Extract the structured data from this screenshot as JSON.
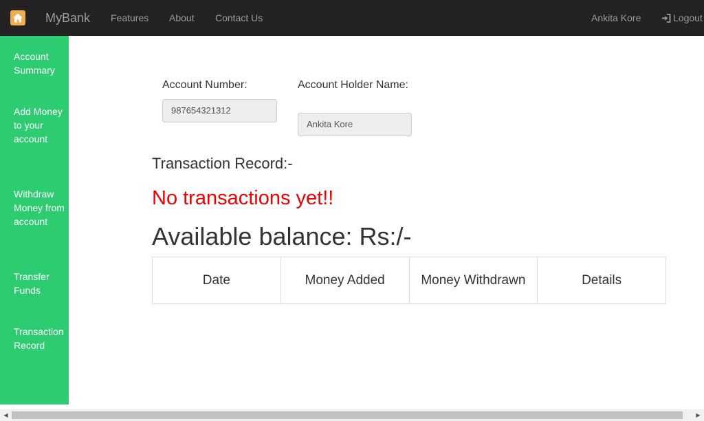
{
  "navbar": {
    "brand": "MyBank",
    "links": [
      "Features",
      "About",
      "Contact Us"
    ],
    "user_name": "Ankita Kore",
    "logout_label": "Logout",
    "bg_color": "#222222",
    "home_badge_color": "#f0ad4e"
  },
  "sidebar": {
    "bg_color": "#2ecc71",
    "items": [
      {
        "label": "Account Summary"
      },
      {
        "label": "Add Money to your account"
      },
      {
        "label": "Withdraw Money from account"
      },
      {
        "label": "Transfer Funds"
      },
      {
        "label": "Transaction Record"
      }
    ]
  },
  "account": {
    "number_label": "Account Number:",
    "number_value": "987654321312",
    "holder_label": "Account Holder Name:",
    "holder_value": "Ankita Kore"
  },
  "transactions": {
    "title": "Transaction Record:-",
    "empty_message": "No transactions yet!!",
    "empty_color": "#ee0000",
    "balance_text": "Available balance: Rs:/-",
    "columns": [
      "Date",
      "Money Added",
      "Money Withdrawn",
      "Details"
    ]
  }
}
